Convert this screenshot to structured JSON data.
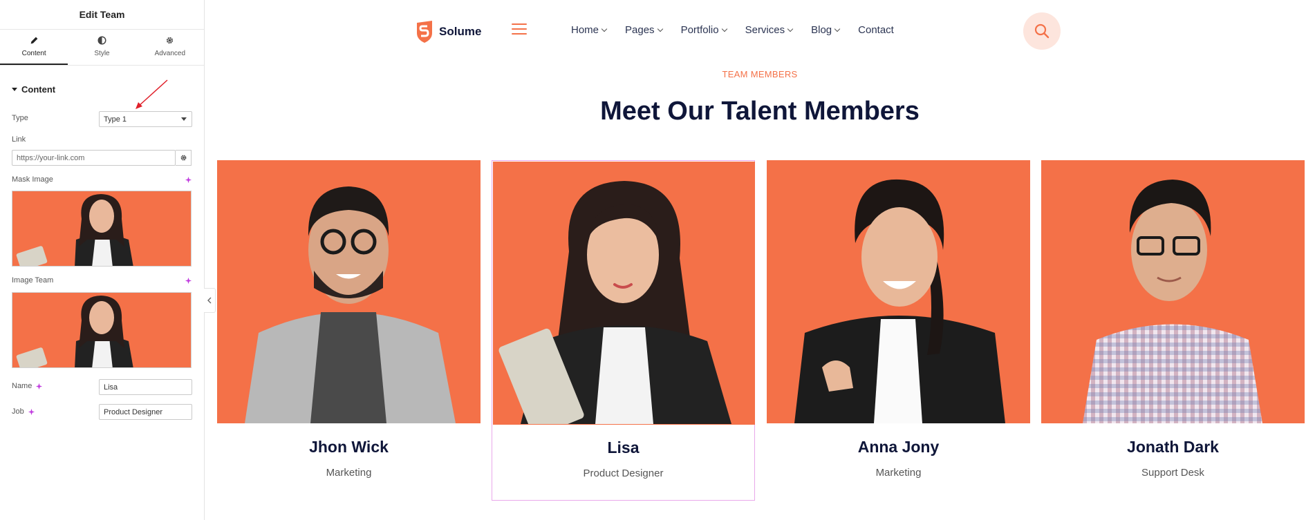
{
  "panel": {
    "title": "Edit Team",
    "tabs": [
      {
        "label": "Content",
        "icon": "pencil-icon"
      },
      {
        "label": "Style",
        "icon": "contrast-icon"
      },
      {
        "label": "Advanced",
        "icon": "gear-icon"
      }
    ],
    "section": "Content",
    "type_label": "Type",
    "type_value": "Type 1",
    "link_label": "Link",
    "link_placeholder": "https://your-link.com",
    "mask_image_label": "Mask Image",
    "image_team_label": "Image Team",
    "name_label": "Name",
    "name_value": "Lisa",
    "job_label": "Job",
    "job_value": "Product Designer"
  },
  "site": {
    "logo_text": "Solume",
    "nav": [
      "Home",
      "Pages",
      "Portfolio",
      "Services",
      "Blog",
      "Contact"
    ],
    "eyebrow": "TEAM MEMBERS",
    "heading": "Meet Our Talent Members"
  },
  "team": [
    {
      "name": "Jhon Wick",
      "job": "Marketing"
    },
    {
      "name": "Lisa",
      "job": "Product Designer"
    },
    {
      "name": "Anna Jony",
      "job": "Marketing"
    },
    {
      "name": "Jonath Dark",
      "job": "Support Desk"
    }
  ],
  "colors": {
    "accent": "#f47148",
    "heading": "#0f1639",
    "selection": "#e9a7ea"
  }
}
